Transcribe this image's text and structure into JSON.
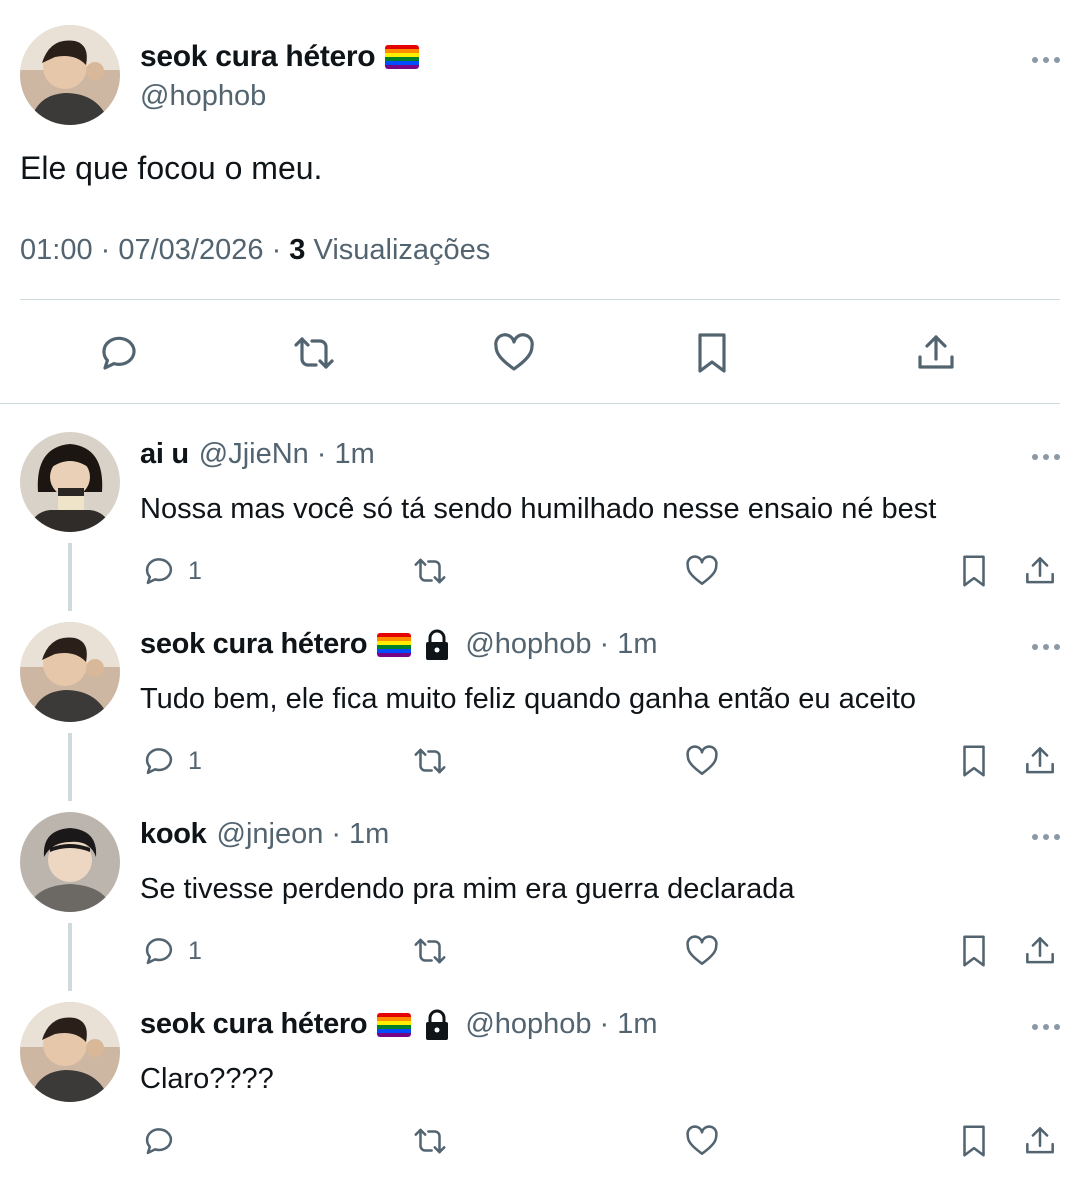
{
  "main_tweet": {
    "display_name": "seok cura hétero",
    "handle": "@hophob",
    "text": "Ele que focou o meu.",
    "time": "01:00",
    "date": "07/03/2026",
    "views_count": "3",
    "views_label": "Visualizações",
    "actions": [
      "reply-icon",
      "retweet-icon",
      "like-icon",
      "bookmark-icon",
      "share-icon"
    ]
  },
  "replies": [
    {
      "display_name": "ai u",
      "handle": "@JjieNn",
      "time": "· 1m",
      "text": "Nossa mas você só tá sendo humilhado nesse ensaio né best",
      "reply_count": "1",
      "has_flag": false,
      "locked": false
    },
    {
      "display_name": "seok cura hétero",
      "handle": "@hophob",
      "time": "· 1m",
      "text": "Tudo bem, ele fica muito feliz quando ganha então eu aceito",
      "reply_count": "1",
      "has_flag": true,
      "locked": true
    },
    {
      "display_name": "kook",
      "handle": "@jnjeon",
      "time": "· 1m",
      "text": "Se tivesse perdendo pra mim era guerra declarada",
      "reply_count": "1",
      "has_flag": false,
      "locked": false
    },
    {
      "display_name": "seok cura hétero",
      "handle": "@hophob",
      "time": "· 1m",
      "text": "Claro????",
      "reply_count": "",
      "has_flag": true,
      "locked": true
    }
  ],
  "colors": {
    "text": "#0f1419",
    "secondary": "#536471",
    "divider": "#cfd9de",
    "icon": "#536471"
  }
}
